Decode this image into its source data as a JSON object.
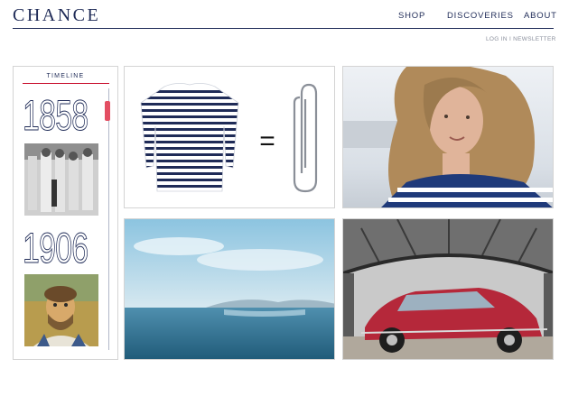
{
  "header": {
    "logo": "CHANCE",
    "nav": [
      "SHOP",
      "DISCOVERIES",
      "ABOUT"
    ],
    "subnav": "LOG IN I NEWSLETTER"
  },
  "timeline": {
    "title": "TIMELINE",
    "years": [
      "1858",
      "1906"
    ]
  },
  "colors": {
    "brand_navy": "#1f2b57",
    "accent_red": "#c8102e",
    "border": "#d4d4d4"
  },
  "tiles": {
    "shirt_equation": "=",
    "icons": [
      "striped-shirt-icon",
      "paperclip-icon"
    ]
  }
}
